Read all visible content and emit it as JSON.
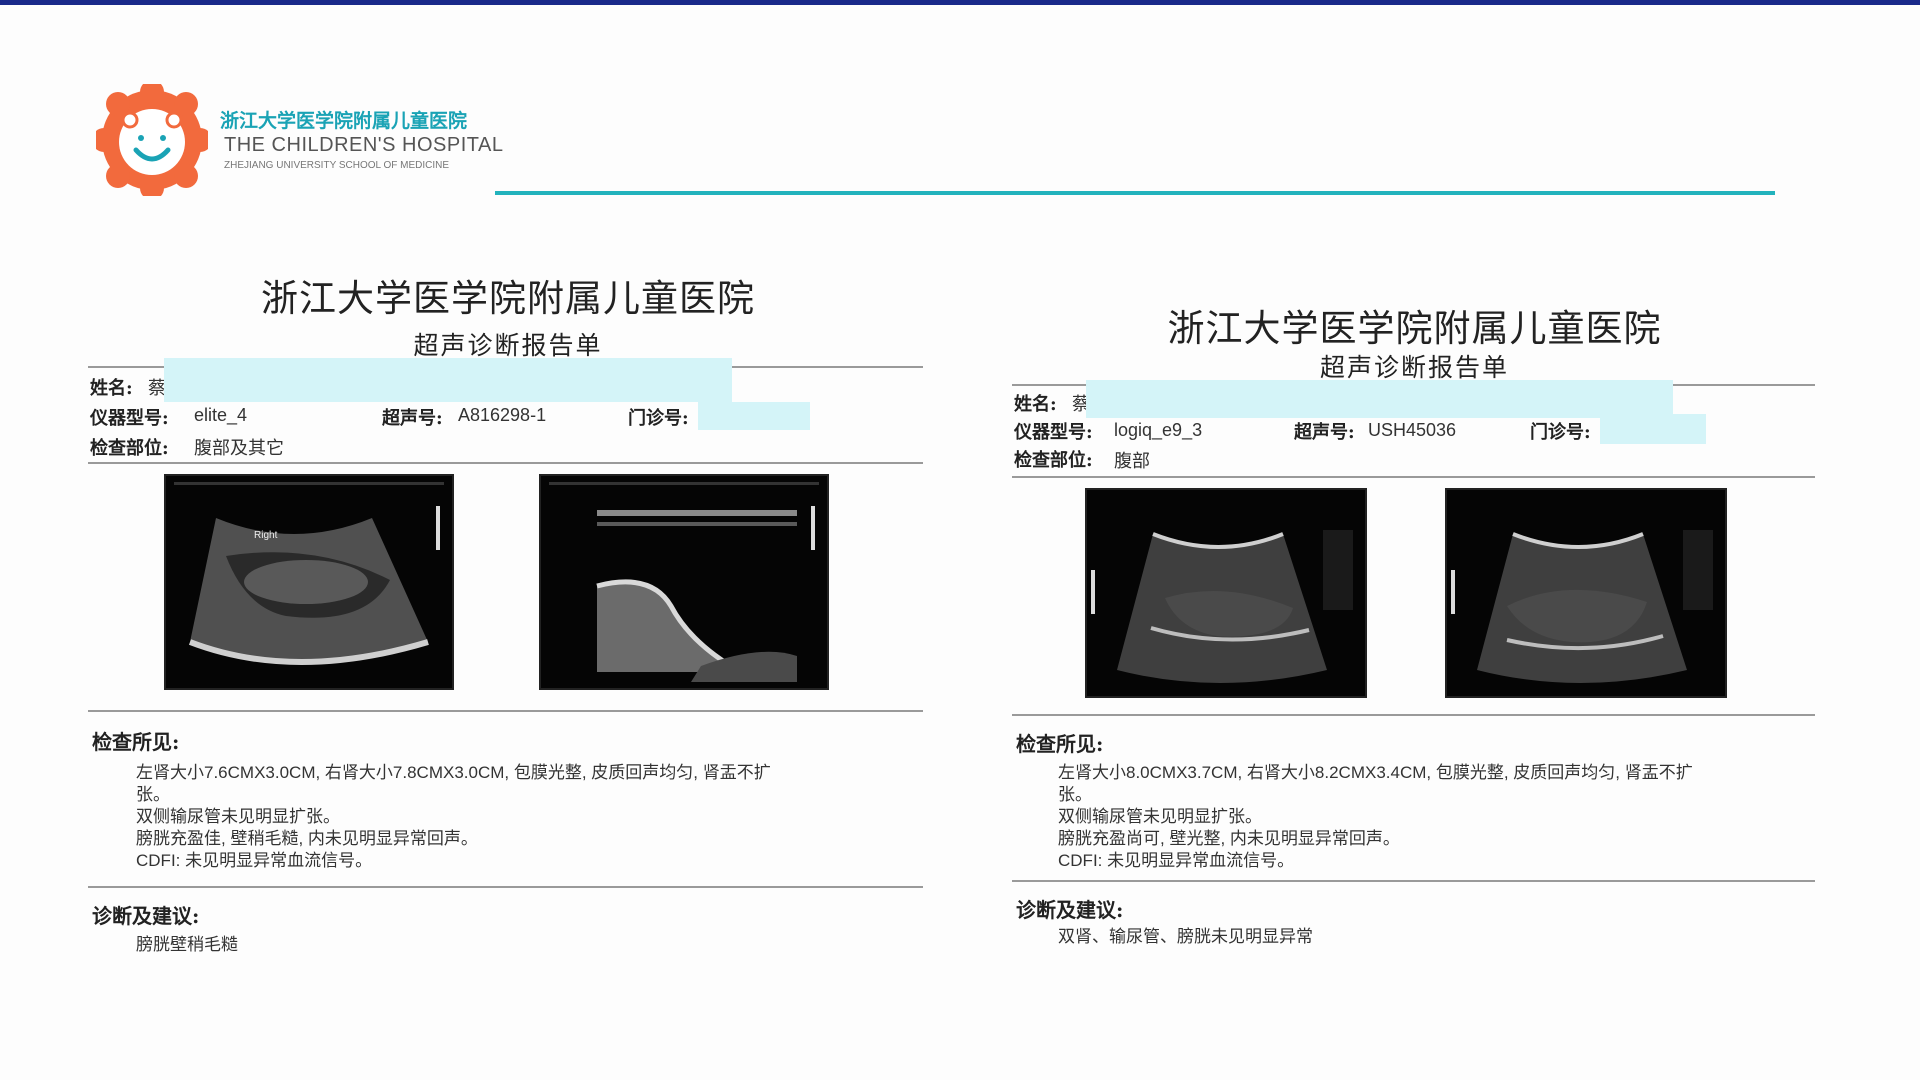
{
  "logo": {
    "cn": "浙江大学医学院附属儿童医院",
    "en_line1": "THE CHILDREN'S HOSPITAL",
    "en_line2": "ZHEJIANG UNIVERSITY SCHOOL OF MEDICINE"
  },
  "colors": {
    "brand_teal": "#23b3bd",
    "logo_orange": "#f26a3d",
    "mask": "#d4f4f8",
    "top_band": "#1a2a8a"
  },
  "reports": [
    {
      "hospital": "浙江大学医学院附属儿童医院",
      "title": "超声诊断报告单",
      "name_label": "姓名:",
      "name_value": "蔡",
      "device_label": "仪器型号:",
      "device_value": "elite_4",
      "us_no_label": "超声号:",
      "us_no_value": "A816298-1",
      "clinic_label": "门诊号:",
      "site_label": "检查部位:",
      "site_value": "腹部及其它",
      "findings_label": "检查所见:",
      "findings": [
        "左肾大小7.6CMX3.0CM, 右肾大小7.8CMX3.0CM, 包膜光整, 皮质回声均匀, 肾盂不扩",
        "张。",
        "双侧输尿管未见明显扩张。",
        "膀胱充盈佳, 壁稍毛糙, 内未见明显异常回声。",
        "CDFI: 未见明显异常血流信号。"
      ],
      "diagnosis_label": "诊断及建议:",
      "diagnosis": "膀胱壁稍毛糙",
      "image1_label": "Right"
    },
    {
      "hospital": "浙江大学医学院附属儿童医院",
      "title": "超声诊断报告单",
      "name_label": "姓名:",
      "name_value": "蔡",
      "device_label": "仪器型号:",
      "device_value": "logiq_e9_3",
      "us_no_label": "超声号:",
      "us_no_value": "USH45036",
      "clinic_label": "门诊号:",
      "site_label": "检查部位:",
      "site_value": "腹部",
      "findings_label": "检查所见:",
      "findings": [
        "左肾大小8.0CMX3.7CM, 右肾大小8.2CMX3.4CM, 包膜光整, 皮质回声均匀, 肾盂不扩",
        "张。",
        "双侧输尿管未见明显扩张。",
        "膀胱充盈尚可, 壁光整, 内未见明显异常回声。",
        "CDFI: 未见明显异常血流信号。"
      ],
      "diagnosis_label": "诊断及建议:",
      "diagnosis": "双肾、输尿管、膀胱未见明显异常"
    }
  ]
}
